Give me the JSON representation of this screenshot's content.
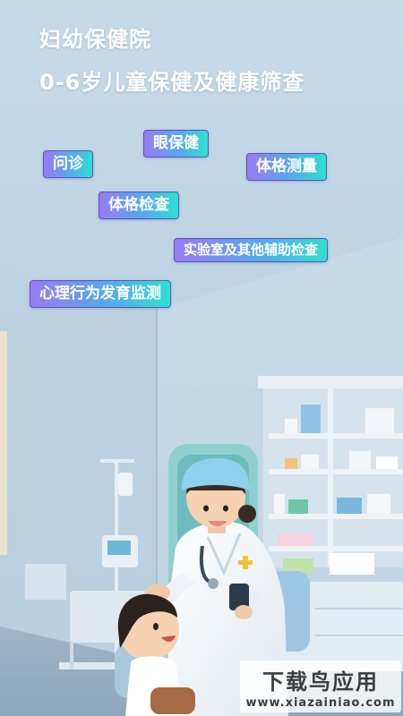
{
  "header": {
    "title": "妇幼保健院",
    "subtitle": "0-6岁儿童保健及健康筛查"
  },
  "tags": {
    "eye_care": "眼保健",
    "consultation": "问诊",
    "body_measurement": "体格测量",
    "physical_exam": "体格检查",
    "lab_tests": "实验室及其他辅助检查",
    "psych_development": "心理行为发育监测"
  },
  "watermark": {
    "cn": "下载鸟应用",
    "en": "www.xiazainiao.com"
  },
  "colors": {
    "tag_gradient_start": "#9a7af2",
    "tag_gradient_end": "#2ee0cf",
    "tag_border": "#5a56b8",
    "heading": "#ffffff"
  }
}
